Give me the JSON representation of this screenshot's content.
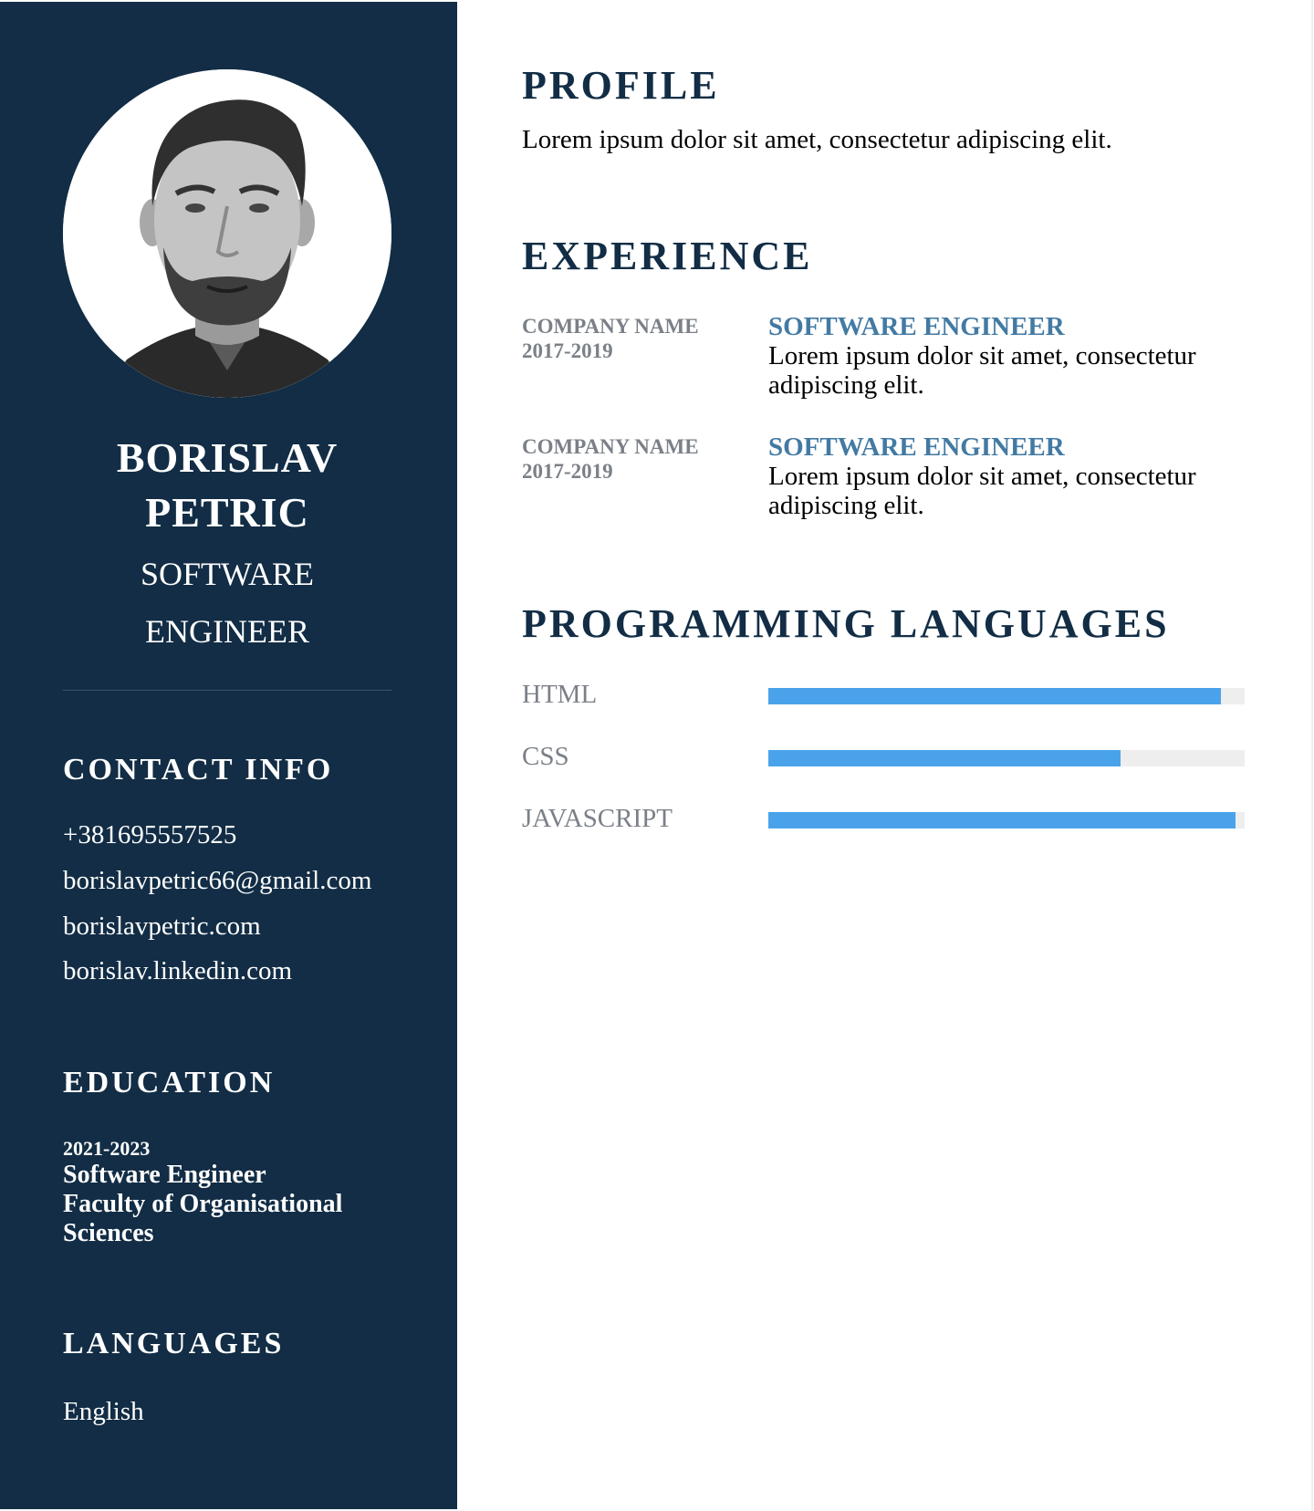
{
  "sidebar": {
    "name_line1": "BORISLAV",
    "name_line2": "PETRIC",
    "role_line1": "SOFTWARE",
    "role_line2": "ENGINEER",
    "contact": {
      "heading": "CONTACT INFO",
      "phone": "+381695557525",
      "email": "borislavpetric66@gmail.com",
      "website": "borislavpetric.com",
      "linkedin": "borislav.linkedin.com"
    },
    "education": {
      "heading": "EDUCATION",
      "years": "2021-2023",
      "degree": "Software Engineer",
      "school": "Faculty of Organisational Sciences"
    },
    "languages": {
      "heading": "LANGUAGES",
      "items": [
        "English"
      ]
    }
  },
  "main": {
    "profile": {
      "heading": "PROFILE",
      "text": "Lorem ipsum dolor sit amet, consectetur adipiscing elit."
    },
    "experience": {
      "heading": "EXPERIENCE",
      "items": [
        {
          "company": "COMPANY NAME",
          "years": "2017-2019",
          "title": "SOFTWARE ENGINEER",
          "desc": "Lorem ipsum dolor sit amet, consectetur adipiscing elit."
        },
        {
          "company": "COMPANY NAME",
          "years": "2017-2019",
          "title": "SOFTWARE ENGINEER",
          "desc": "Lorem ipsum dolor sit amet, consectetur adipiscing elit."
        }
      ]
    },
    "programming": {
      "heading": "PROGRAMMING LANGUAGES",
      "skills": [
        {
          "name": "HTML",
          "level": 0.95
        },
        {
          "name": "CSS",
          "level": 0.74
        },
        {
          "name": "JAVASCRIPT",
          "level": 0.98
        }
      ]
    }
  },
  "colors": {
    "sidebar_bg": "#122d45",
    "heading": "#122d45",
    "accent_title": "#437aa3",
    "muted": "#7b8088",
    "bar_fill": "#4aa3ea",
    "bar_track": "#eeeeee"
  },
  "icons": {
    "avatar": "profile-photo"
  }
}
